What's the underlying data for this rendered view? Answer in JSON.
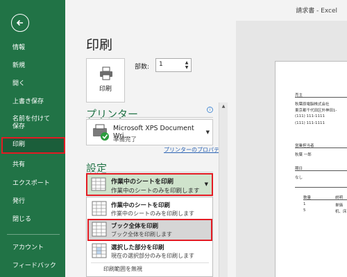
{
  "window": {
    "title": "請求書 - Excel"
  },
  "sidebar": {
    "back_icon": "back-arrow-icon",
    "items": [
      {
        "label": "情報"
      },
      {
        "label": "新規"
      },
      {
        "label": "開く"
      },
      {
        "label": "上書き保存"
      },
      {
        "label": "名前を付けて保存"
      },
      {
        "label": "印刷"
      },
      {
        "label": "共有"
      },
      {
        "label": "エクスポート"
      },
      {
        "label": "発行"
      },
      {
        "label": "閉じる"
      },
      {
        "label": "アカウント"
      },
      {
        "label": "フィードバック"
      }
    ]
  },
  "main": {
    "title": "印刷",
    "print_button_label": "印刷",
    "copies_label": "部数:",
    "copies_value": "1",
    "printer_section": "プリンター",
    "printer_name": "Microsoft XPS Document Wri…",
    "printer_status": "準備完了",
    "printer_properties": "プリンターのプロパティ",
    "settings_section": "設定",
    "selected_option": {
      "title": "作業中のシートを印刷",
      "desc": "作業中のシートのみを印刷します"
    },
    "options": [
      {
        "title": "作業中のシートを印刷",
        "desc": "作業中のシートのみを印刷します"
      },
      {
        "title": "ブック全体を印刷",
        "desc": "ブック全体を印刷します"
      },
      {
        "title": "選択した部分を印刷",
        "desc": "現在の選択部分のみを印刷します"
      }
    ],
    "ignore_print_area": "印刷範囲を無視"
  },
  "preview": {
    "lines": [
      "売主",
      "秋葉原電脳株式会社",
      "東京都千代田区外神田1-",
      "(111) 111-1111",
      "(111) 111-1111",
      "営業担当者",
      "秋葉 一郎",
      "期日",
      "なし",
      "数量",
      "説明",
      "1",
      "単価",
      "5",
      "机、床"
    ]
  },
  "colors": {
    "accent": "#217346",
    "highlight": "#e31b23",
    "selected_bg": "#cfe3cc"
  }
}
